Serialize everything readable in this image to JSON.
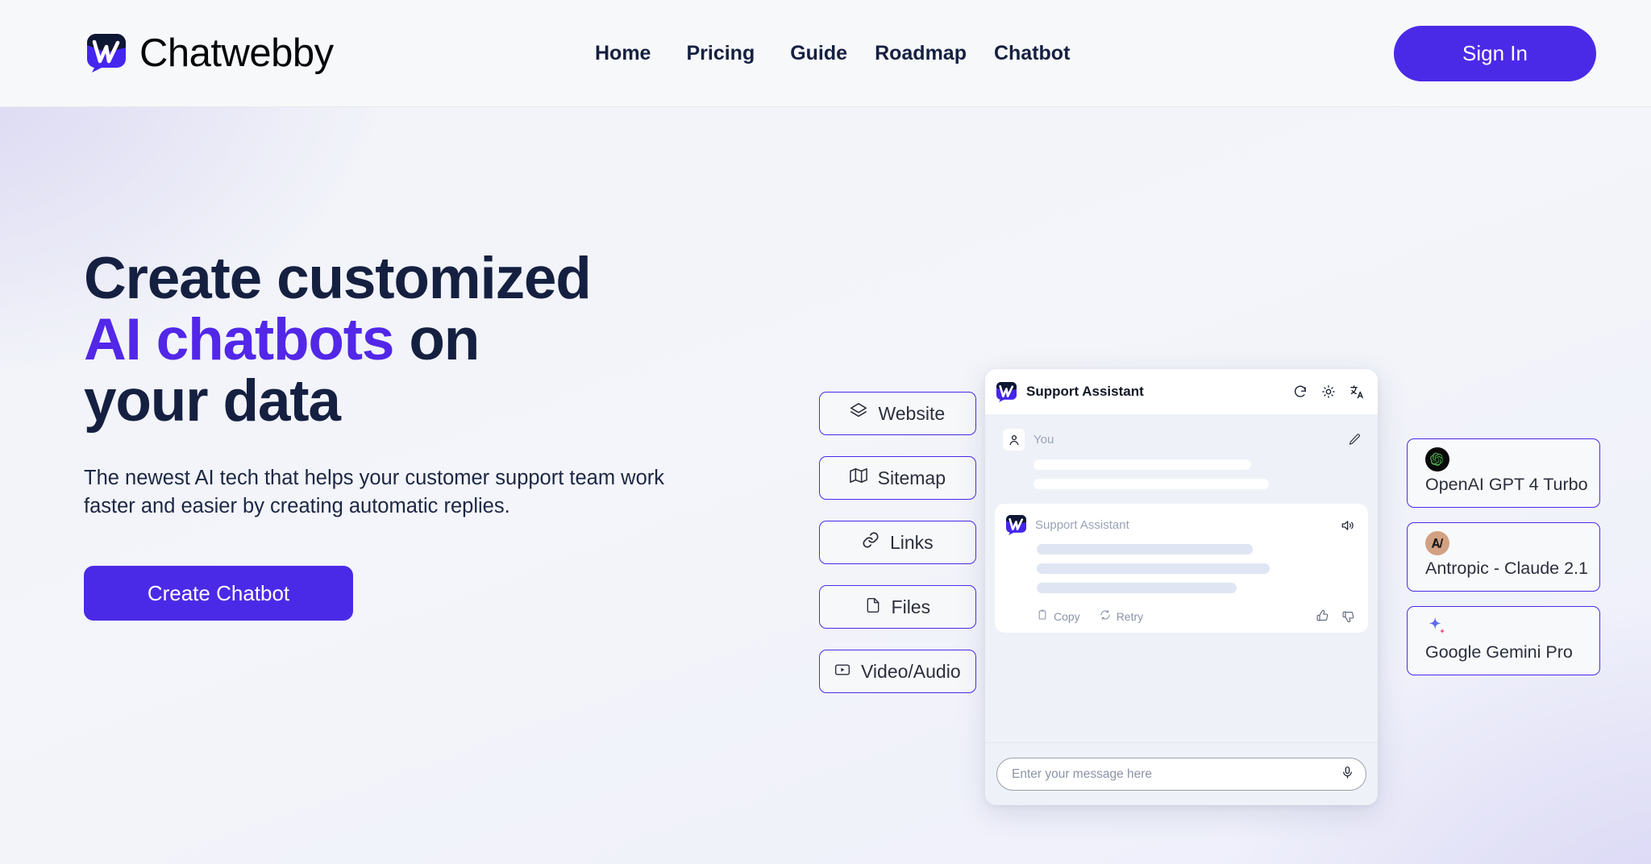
{
  "header": {
    "brand_name": "Chatwebby",
    "logo_icon": "chatwebby-logo",
    "nav": [
      {
        "label": "Home"
      },
      {
        "label": "Pricing"
      },
      {
        "label": "Guide"
      },
      {
        "label": "Roadmap"
      },
      {
        "label": "Chatbot"
      }
    ],
    "signin_label": "Sign In"
  },
  "hero": {
    "headline_line1": "Create customized",
    "headline_accent": "AI chatbots",
    "headline_line2_tail": " on",
    "headline_line3": "your data",
    "subcopy": "The newest AI tech that helps your customer support team work faster and easier by creating automatic replies.",
    "cta_label": "Create Chatbot"
  },
  "sources": [
    {
      "label": "Website",
      "icon": "layers-icon"
    },
    {
      "label": "Sitemap",
      "icon": "map-icon"
    },
    {
      "label": "Links",
      "icon": "link-icon"
    },
    {
      "label": "Files",
      "icon": "file-icon"
    },
    {
      "label": "Video/Audio",
      "icon": "video-play-icon"
    }
  ],
  "widget": {
    "title": "Support Assistant",
    "header_icons": [
      "refresh-icon",
      "sun-icon",
      "translate-icon"
    ],
    "user_message": {
      "sender": "You",
      "avatar_icon": "user-icon",
      "action_icon": "pencil-icon"
    },
    "bot_message": {
      "sender": "Support Assistant",
      "avatar_icon": "chatwebby-logo",
      "action_icon": "speaker-icon",
      "copy_label": "Copy",
      "copy_icon": "clipboard-icon",
      "retry_label": "Retry",
      "retry_icon": "refresh-icon",
      "like_icon": "thumbs-up-icon",
      "dislike_icon": "thumbs-down-icon"
    },
    "composer": {
      "placeholder": "Enter your message here",
      "mic_icon": "microphone-icon"
    }
  },
  "models": [
    {
      "label": "OpenAI GPT 4 Turbo",
      "icon": "openai-icon"
    },
    {
      "label": "Antropic - Claude 2.1",
      "icon": "anthropic-icon"
    },
    {
      "label": "Google Gemini Pro",
      "icon": "gemini-sparkle-icon"
    }
  ],
  "colors": {
    "accent": "#4b2ae7",
    "accent_text": "#5227e8",
    "heading": "#152041",
    "header_bg": "#f7f8f9"
  }
}
